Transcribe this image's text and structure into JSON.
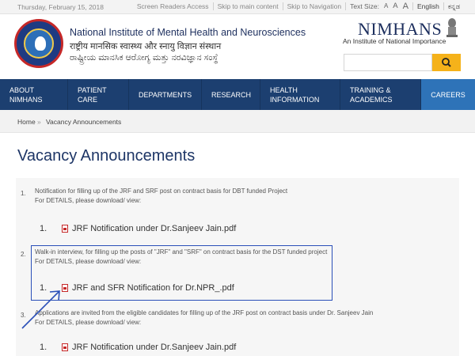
{
  "topbar": {
    "date": "Thursday, February 15, 2018",
    "screen_readers": "Screen Readers Access",
    "skip_main": "Skip to main content",
    "skip_nav": "Skip to Navigation",
    "text_size_label": "Text Size:",
    "text_sizes": [
      "A",
      "A",
      "A"
    ],
    "language": "English",
    "kannada_link": "ಕನ್ನಡ"
  },
  "header": {
    "institute_en": "National Institute of Mental Health and Neurosciences",
    "institute_hi": "राष्ट्रीय मानसिक स्वास्थ्य और स्नायु विज्ञान संस्थान",
    "institute_kn": "ರಾಷ್ಟ್ರೀಯ ಮಾನಸಿಕ ಆರೋಗ್ಯ ಮತ್ತು ನರವಿಜ್ಞಾನ ಸಂಸ್ಥೆ",
    "brand": "NIMHANS",
    "tagline": "An Institute of National Importance",
    "search_placeholder": ""
  },
  "nav": [
    {
      "line1": "ABOUT",
      "line2": "NIMHANS"
    },
    {
      "line1": "PATIENT",
      "line2": "CARE"
    },
    {
      "line1": "DEPARTMENTS",
      "line2": ""
    },
    {
      "line1": "RESEARCH",
      "line2": ""
    },
    {
      "line1": "HEALTH",
      "line2": "INFORMATION"
    },
    {
      "line1": "TRAINING &",
      "line2": "ACADEMICS"
    },
    {
      "line1": "CAREERS",
      "line2": ""
    }
  ],
  "breadcrumb": {
    "home": "Home",
    "separator": "»",
    "current": "Vacancy Announcements"
  },
  "page_title": "Vacancy Announcements",
  "announcements": [
    {
      "number": "1.",
      "line1": "Notification for filling up of the JRF and SRF post on contract basis for DBT funded Project",
      "line2": "For DETAILS, please download/ view:",
      "file_number": "1.",
      "file": "JRF Notification under Dr.Sanjeev Jain.pdf"
    },
    {
      "number": "2.",
      "line1": "Walk-in interview, for filling up the posts of \"JRF\" and \"SRF\" on contract basis for the DST funded project",
      "line2": "For DETAILS, please download/ view:",
      "file_number": "1.",
      "file": "JRF and SFR Notification for Dr.NPR_.pdf"
    },
    {
      "number": "3.",
      "line1": "Applications are invited from the eligible candidates for filling up of the JRF post on contract basis under Dr. Sanjeev Jain",
      "line2": "For DETAILS, please download/ view:",
      "file_number": "1.",
      "file": "JRF Notification under Dr.Sanjeev Jain.pdf"
    }
  ],
  "colors": {
    "nav_bg": "#1c3f70",
    "nav_active": "#2e73b8",
    "search_btn": "#f5b21a",
    "highlight": "#2a4fb8",
    "title": "#1d3566"
  }
}
